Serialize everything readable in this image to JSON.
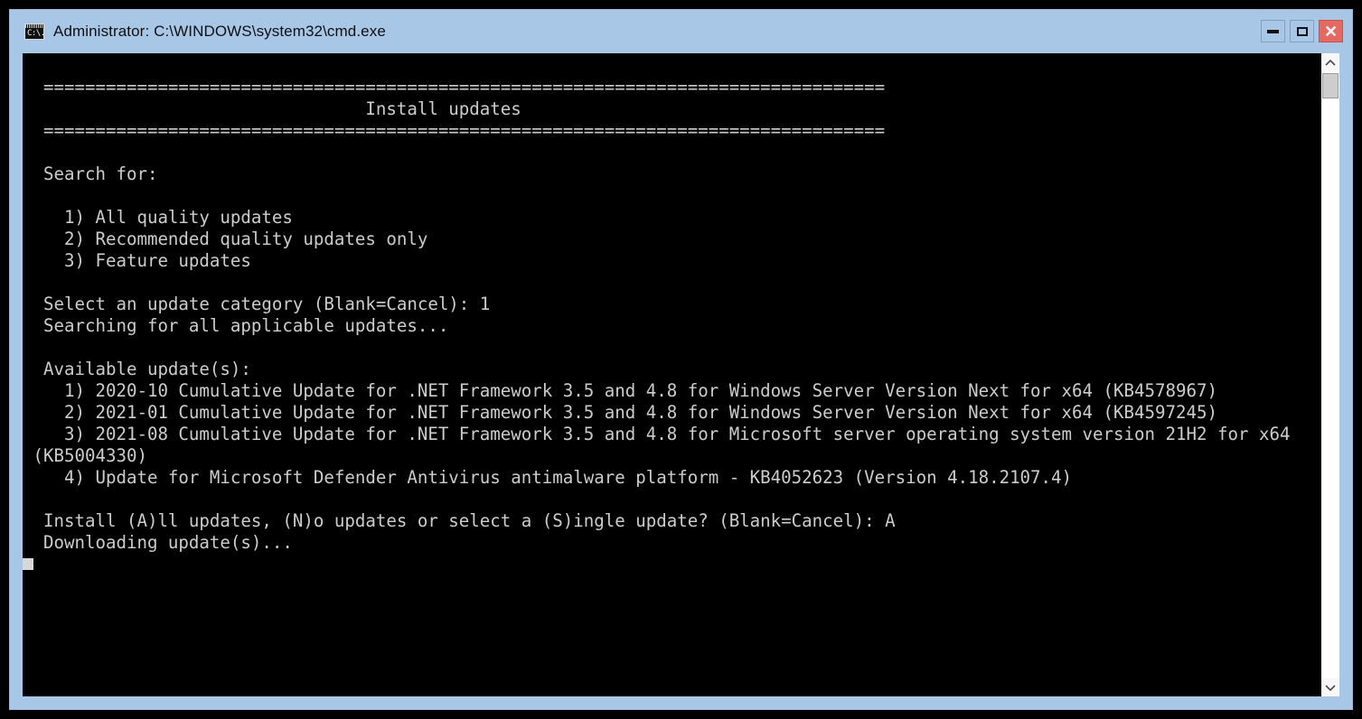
{
  "window": {
    "title": "Administrator: C:\\WINDOWS\\system32\\cmd.exe",
    "icon": "cmd-console-icon",
    "icon_glyph": "C:\\.",
    "titlebar_color": "#a8c7e6",
    "console_bg": "#000000",
    "console_fg": "#cccccc",
    "close_button_color": "#e8685f"
  },
  "controls": {
    "minimize_label": "—",
    "maximize_label": "□",
    "close_label": "✕"
  },
  "scrollbar": {
    "up_arrow": "scroll-up-arrow",
    "down_arrow": "scroll-down-arrow",
    "thumb": "scroll-thumb"
  },
  "console": {
    "separator": "=================================================================================",
    "header_title": "Install updates",
    "header_title_indent": 32,
    "lines": [
      "  =================================================================================",
      "                                 Install updates",
      "  =================================================================================",
      "",
      "  Search for:",
      "",
      "    1) All quality updates",
      "    2) Recommended quality updates only",
      "    3) Feature updates",
      "",
      "  Select an update category (Blank=Cancel): 1",
      "  Searching for all applicable updates...",
      "",
      "  Available update(s):",
      "    1) 2020-10 Cumulative Update for .NET Framework 3.5 and 4.8 for Windows Server Version Next for x64 (KB4578967)",
      "    2) 2021-01 Cumulative Update for .NET Framework 3.5 and 4.8 for Windows Server Version Next for x64 (KB4597245)",
      "    3) 2021-08 Cumulative Update for .NET Framework 3.5 and 4.8 for Microsoft server operating system version 21H2 for x64 (KB5004330)",
      "    4) Update for Microsoft Defender Antivirus antimalware platform - KB4052623 (Version 4.18.2107.4)",
      "",
      "  Install (A)ll updates, (N)o updates or select a (S)ingle update? (Blank=Cancel): A",
      "  Downloading update(s)..."
    ],
    "menu_options": [
      {
        "index": "1)",
        "label": "All quality updates"
      },
      {
        "index": "2)",
        "label": "Recommended quality updates only"
      },
      {
        "index": "3)",
        "label": "Feature updates"
      }
    ],
    "category_prompt": "Select an update category (Blank=Cancel):",
    "category_answer": "1",
    "searching_status": "Searching for all applicable updates...",
    "available_header": "Available update(s):",
    "available_updates": [
      {
        "index": "1)",
        "label": "2020-10 Cumulative Update for .NET Framework 3.5 and 4.8 for Windows Server Version Next for x64 (KB4578967)",
        "kb": "KB4578967"
      },
      {
        "index": "2)",
        "label": "2021-01 Cumulative Update for .NET Framework 3.5 and 4.8 for Windows Server Version Next for x64 (KB4597245)",
        "kb": "KB4597245"
      },
      {
        "index": "3)",
        "label": "2021-08 Cumulative Update for .NET Framework 3.5 and 4.8 for Microsoft server operating system version 21H2 for x64 (KB5004330)",
        "kb": "KB5004330"
      },
      {
        "index": "4)",
        "label": "Update for Microsoft Defender Antivirus antimalware platform - KB4052623 (Version 4.18.2107.4)",
        "kb": "KB4052623"
      }
    ],
    "install_prompt": "Install (A)ll updates, (N)o updates or select a (S)ingle update? (Blank=Cancel):",
    "install_answer": "A",
    "download_status": "Downloading update(s)...",
    "search_for_label": "Search for:"
  }
}
